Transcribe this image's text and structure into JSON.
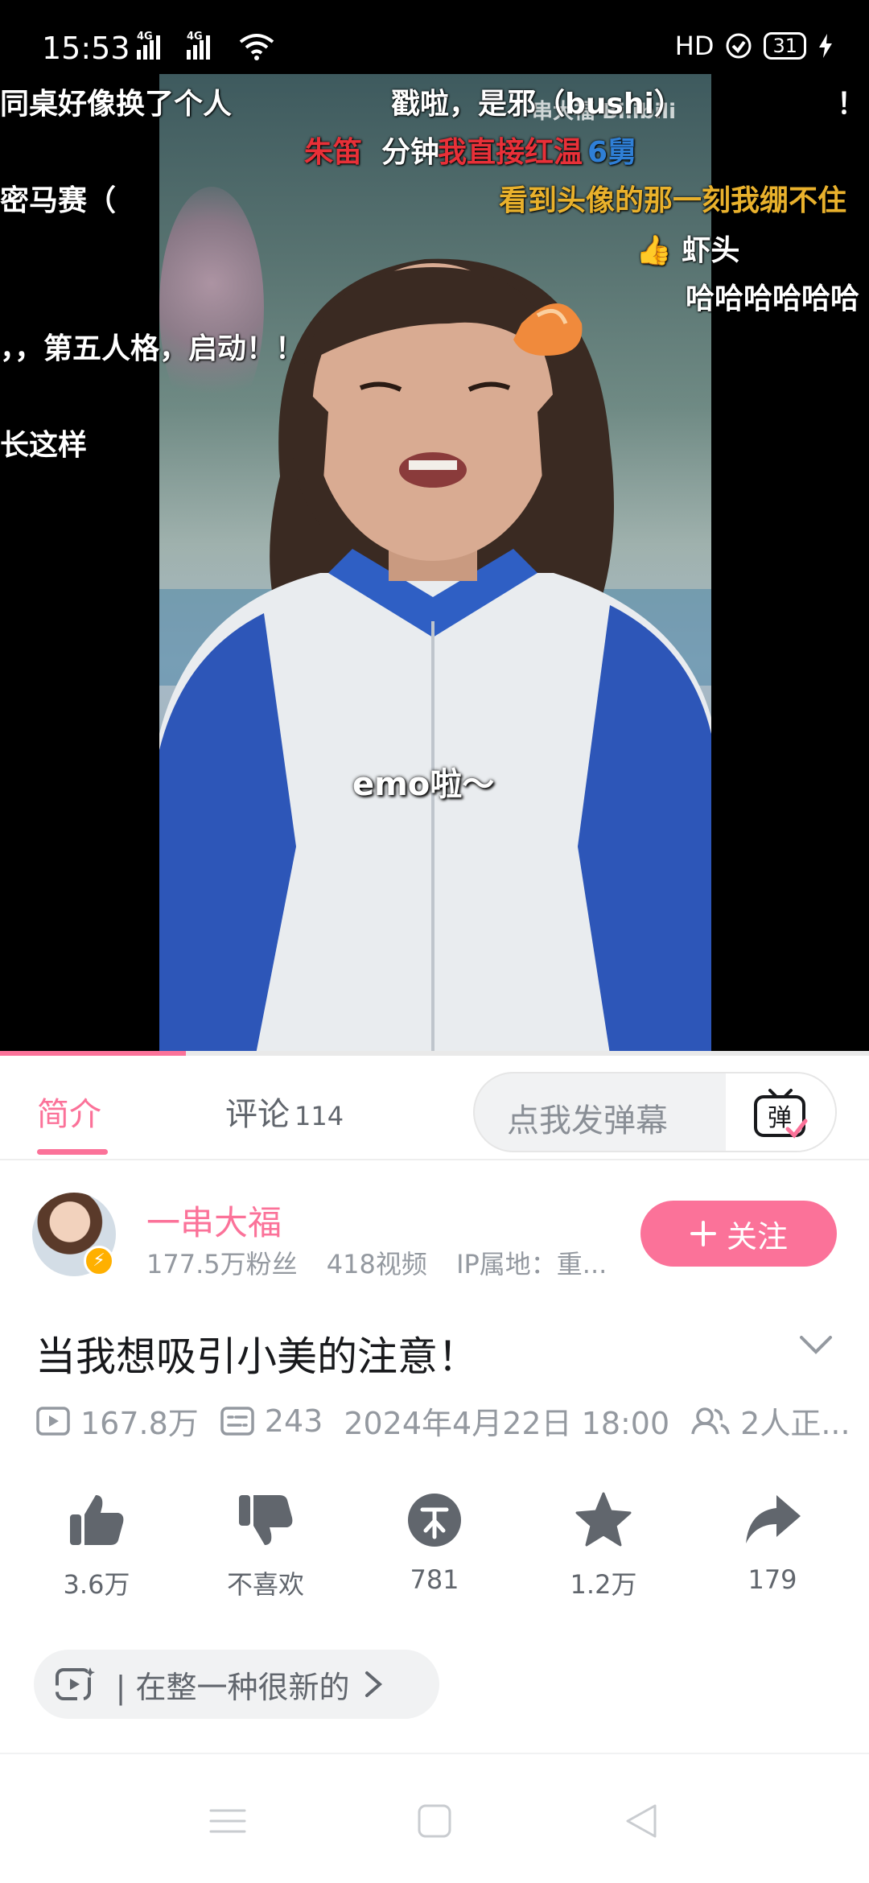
{
  "status_bar": {
    "time": "15:53",
    "network_1": "4G",
    "network_2": "4G",
    "hd_label": "HD",
    "battery": "31"
  },
  "video": {
    "watermark": "串大福 Bilibili",
    "caption": "emo啦～",
    "danmaku": [
      {
        "text": "同桌好像换了个人",
        "color": "white"
      },
      {
        "text": "戳啦，是邪（bushi）",
        "color": "white"
      },
      {
        "text": "！",
        "color": "white"
      },
      {
        "text": "朱笛",
        "color": "red"
      },
      {
        "text": "分钟",
        "color": "white"
      },
      {
        "text": "我直接红温",
        "color": "red"
      },
      {
        "text": "6舅",
        "color": "blue"
      },
      {
        "text": "密马赛（",
        "color": "white"
      },
      {
        "text": "看到头像的那一刻我绷不住",
        "color": "gold"
      },
      {
        "text": "虾头",
        "color": "white"
      },
      {
        "text": "哈哈哈哈哈哈",
        "color": "white"
      },
      {
        "text": "，，第五人格，启动！！",
        "color": "white"
      },
      {
        "text": "长这样",
        "color": "white"
      }
    ],
    "progress": 0.214
  },
  "tabs": {
    "intro": "简介",
    "comments": "评论",
    "comments_count": "114",
    "danmaku_placeholder": "点我发弹幕",
    "danmaku_toggle": "弹"
  },
  "uploader": {
    "name": "一串大福",
    "fans": "177.5万粉丝",
    "videos": "418视频",
    "ip": "IP属地：重...",
    "follow_label": "关注"
  },
  "video_info": {
    "title": "当我想吸引小美的注意！",
    "views": "167.8万",
    "danmaku_count": "243",
    "publish_time": "2024年4月22日 18:00",
    "watching": "2人正..."
  },
  "actions": [
    {
      "name": "like",
      "label": "3.6万"
    },
    {
      "name": "dislike",
      "label": "不喜欢"
    },
    {
      "name": "coin",
      "label": "781"
    },
    {
      "name": "favorite",
      "label": "1.2万"
    },
    {
      "name": "share",
      "label": "179"
    }
  ],
  "tag_chip": {
    "text": " | 在整一种很新的"
  },
  "colors": {
    "brand_pink": "#fb7299",
    "text_primary": "#18191c",
    "text_secondary": "#9499a0"
  }
}
